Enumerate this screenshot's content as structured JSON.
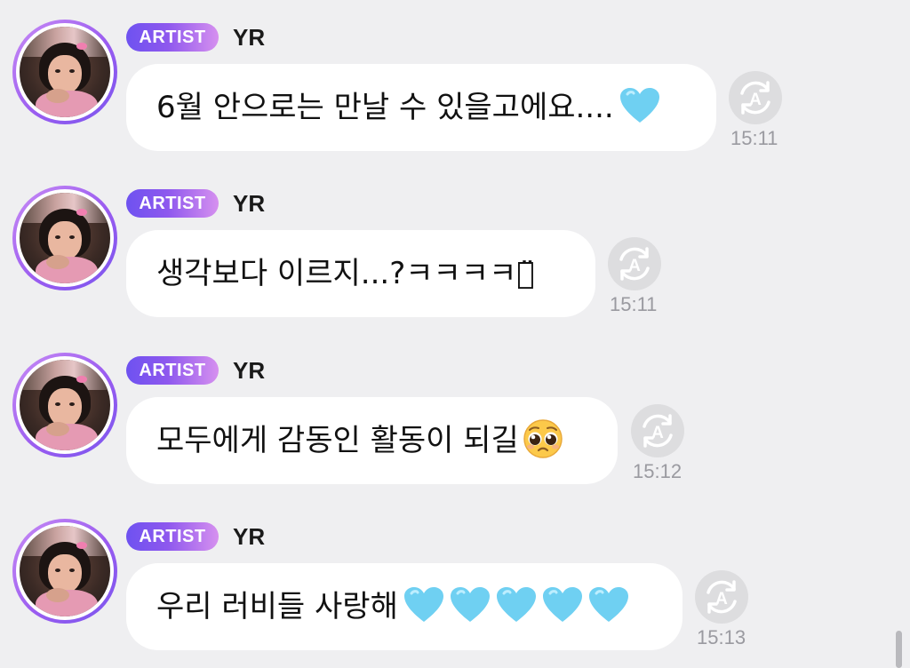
{
  "messages": [
    {
      "badge": "ARTIST",
      "sender": "YR",
      "text": "6월 안으로는 만날 수 있을고에요....",
      "emoji": [
        "blue-heart"
      ],
      "time": "15:11"
    },
    {
      "badge": "ARTIST",
      "sender": "YR",
      "text": "생각보다 이르지...?ㅋㅋㅋㅋㅋ̈",
      "emoji": [],
      "time": "15:11"
    },
    {
      "badge": "ARTIST",
      "sender": "YR",
      "text": "모두에게 감동인 활동이 되길",
      "emoji": [
        "pleading-face"
      ],
      "time": "15:12"
    },
    {
      "badge": "ARTIST",
      "sender": "YR",
      "text": "우리 러비들 사랑해",
      "emoji": [
        "blue-heart",
        "blue-heart",
        "blue-heart",
        "blue-heart",
        "blue-heart"
      ],
      "time": "15:13"
    }
  ],
  "icons": {
    "translate": "translate-icon",
    "avatar": "artist-avatar"
  },
  "colors": {
    "background": "#efeff1",
    "bubble": "#ffffff",
    "badge_start": "#6e52f0",
    "badge_end": "#d690ef",
    "heart": "#6fd0f2",
    "time": "#9a9aa0",
    "translate_icon_bg": "#dddddf"
  }
}
